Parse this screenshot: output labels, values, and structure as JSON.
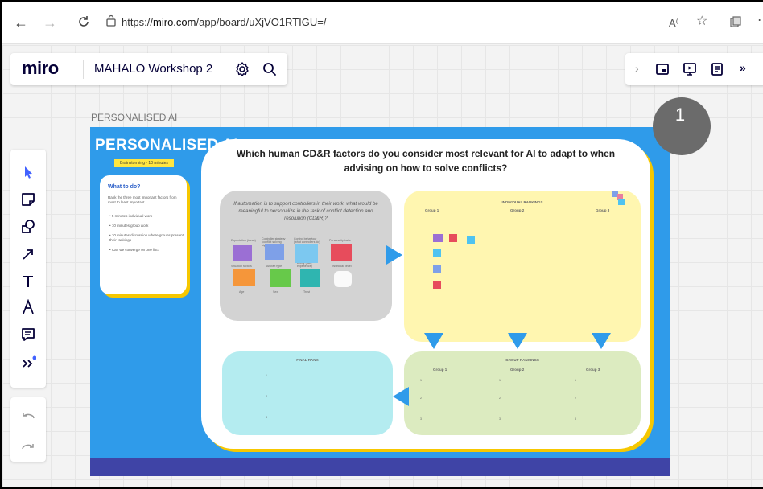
{
  "browser": {
    "url_prefix": "https://",
    "url_host": "miro.com",
    "url_path": "/app/board/uXjVO1RTIGU=/"
  },
  "app": {
    "logo": "miro",
    "board_name": "MAHALO Workshop 2"
  },
  "frame_label": "PERSONALISED AI",
  "badge_number": "1",
  "board": {
    "title": "PERSONALISED AI",
    "tag": "Brainstorming · 10 minutes",
    "question": "Which human CD&R factors do you consider most relevant for AI to adapt to when advising on how to solve conflicts?",
    "what_card": {
      "heading": "What to do?",
      "desc": "Rank the three most important factors from most to least important.",
      "items": [
        "5 minutes individual work",
        "10 minutes group work",
        "10 minutes discussion where groups present their rankings",
        "Can we converge on one list?"
      ]
    },
    "factors_prompt": "If automation is to support controllers in their work, what would be meaningful to personalize in the task of conflict detection and resolution (CD&R)?",
    "factor_labels": [
      "Expectation (ideas)",
      "Controller strategy (conflict solving style)",
      "Control behaviour (what controllers do)",
      "Personality traits",
      "Situation factors",
      "Aircraft type",
      "Ability (skill, experience)",
      "Workload level",
      "Age",
      "Sex",
      "Trust"
    ],
    "individual_rankings": {
      "title": "INDIVIDUAL RANKINGS",
      "groups": [
        "Group 1",
        "Group 2",
        "Group 3"
      ]
    },
    "group_rankings": {
      "title": "GROUP RANKINGS",
      "groups": [
        "Group 1",
        "Group 2",
        "Group 3"
      ],
      "ranks": [
        "1",
        "2",
        "3"
      ]
    },
    "final_rank": {
      "title": "FINAL RANK",
      "ranks": [
        "1",
        "2",
        "3"
      ]
    }
  },
  "colors": {
    "board_blue": "#2f9bea",
    "footer_indigo": "#3f44a6",
    "accent_yellow": "#f6c700",
    "miro_navy": "#050038",
    "tool_blue": "#4262ff"
  },
  "icons": {
    "back": "arrow-left-icon",
    "forward": "arrow-right-icon",
    "refresh": "refresh-icon",
    "settings": "gear-icon",
    "search": "search-icon"
  }
}
